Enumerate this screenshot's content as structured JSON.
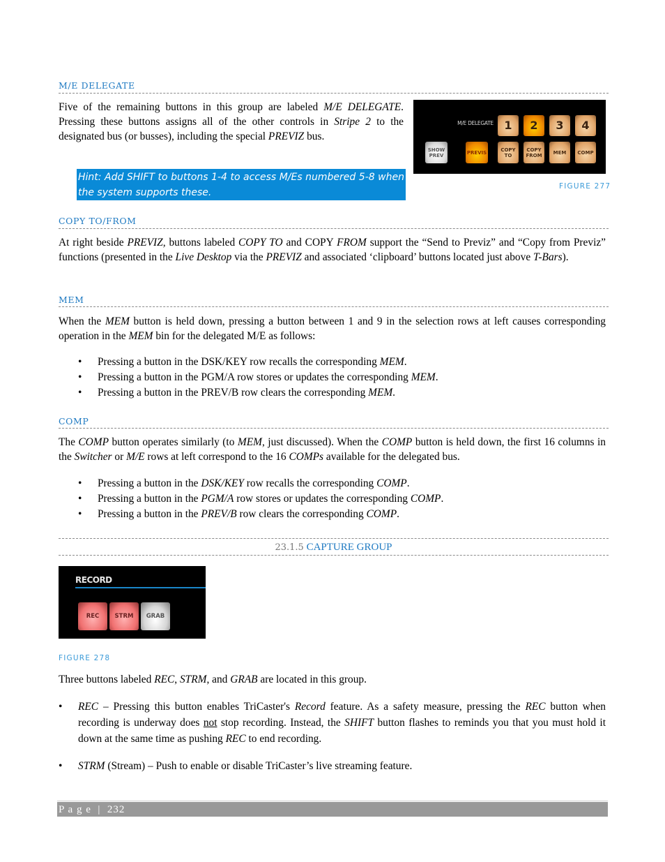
{
  "sections": {
    "me_delegate": {
      "heading": "M/E DELEGATE",
      "para": {
        "t1": "Five of the remaining buttons in this group are labeled ",
        "i1": "M/E DELEGATE",
        "t2": ". Pressing these buttons assigns all of the other controls in ",
        "i2": "Stripe 2",
        "t3": " to the designated bus (or busses), including the special ",
        "i3": "PREVIZ",
        "t4": " bus."
      },
      "hint": "Hint: Add SHIFT to buttons 1-4 to access M/Es numbered 5-8 when the system supports these."
    },
    "copy_to_from": {
      "heading": "COPY TO/FROM",
      "para": {
        "t1": "At right beside ",
        "i1": "PREVIZ,",
        "t2": " buttons labeled ",
        "i2": "COPY TO",
        "t3": " and COPY ",
        "i3": "FROM",
        "t4": " support the “Send to Previz” and “Copy from Previz” functions (presented in the ",
        "i4": "Live Desktop",
        "t5": " via the ",
        "i5": "PREVIZ",
        "t6": " and associated ‘clipboard’ buttons located just above ",
        "i6": "T-Bars",
        "t7": ")."
      }
    },
    "mem": {
      "heading": "MEM",
      "para": {
        "t1": "When the ",
        "i1": "MEM",
        "t2": " button is held down, pressing a button between 1 and 9 in the selection rows at left causes corresponding operation in the ",
        "i2": "MEM",
        "t3": " bin for the delegated M/E as follows:"
      },
      "bullets": [
        {
          "t1": "Pressing a button in the DSK/KEY row recalls the corresponding ",
          "i1": "MEM",
          "t2": "."
        },
        {
          "t1": "Pressing a button in the PGM/A row stores or updates the corresponding ",
          "i1": "MEM",
          "t2": "."
        },
        {
          "t1": "Pressing a button in the PREV/B row clears the corresponding ",
          "i1": "MEM",
          "t2": "."
        }
      ]
    },
    "comp": {
      "heading": "COMP",
      "para": {
        "t1": "The ",
        "i1": "COMP",
        "t2": " button operates similarly (to ",
        "i2": "MEM",
        "t3": ", just discussed). When the ",
        "i3": "COMP",
        "t4": " button is held down, the first 16 columns in the ",
        "i4": "Switcher",
        "t5": " or ",
        "i5": "M/E",
        "t6": " rows at left correspond to the 16 ",
        "i6": "COMPs",
        "t7": " available for the delegated bus."
      },
      "bullets": [
        {
          "t1": "Pressing a button in the ",
          "i1": "DSK/KEY",
          "t2": " row recalls the corresponding ",
          "i2": "COMP",
          "t3": "."
        },
        {
          "t1": "Pressing a button in the ",
          "i1": "PGM/A",
          "t2": " row stores or updates the corresponding ",
          "i2": "COMP",
          "t3": "."
        },
        {
          "t1": "Pressing a button in the ",
          "i1": "PREV/B",
          "t2": " row clears the corresponding ",
          "i2": "COMP",
          "t3": "."
        }
      ]
    },
    "capture_group": {
      "number": "23.1.5",
      "title": "CAPTURE GROUP",
      "intro": {
        "t1": "Three buttons labeled ",
        "i1": "REC",
        "t2": ", ",
        "i2": "STRM",
        "t3": ", and ",
        "i3": "GRAB",
        "t4": " are located in this group."
      },
      "bullets": [
        {
          "i1": "REC",
          "t1": " – Pressing this button enables TriCaster's ",
          "i2": "Record",
          "t2": " feature.  As a safety measure, pressing the ",
          "i3": "REC",
          "t3": " button when recording is underway does ",
          "u1": "not",
          "t4": " stop recording.   Instead, the ",
          "i4": "SHIFT",
          "t5": " button flashes to reminds you that you must hold it down at the same time as pushing ",
          "i5": "REC",
          "t6": " to end recording."
        },
        {
          "i1": "STRM",
          "t1": " (Stream) – Push to enable or disable TriCaster’s live streaming feature."
        }
      ]
    }
  },
  "figures": {
    "fig277": {
      "caption": "FIGURE 277",
      "me_label": "M/E DELEGATE",
      "top_buttons": [
        "1",
        "2",
        "3",
        "4"
      ],
      "active_top": "2",
      "show_prev": "SHOW PREV",
      "previs": "PREVIS",
      "copy_to": "COPY TO",
      "copy_from": "COPY FROM",
      "mem": "MEM",
      "comp": "COMP"
    },
    "fig278": {
      "caption": "FIGURE 278",
      "group_label": "RECORD",
      "buttons": [
        "REC",
        "STRM",
        "GRAB"
      ]
    }
  },
  "footer": {
    "page_label": "P a g e  |  232"
  }
}
